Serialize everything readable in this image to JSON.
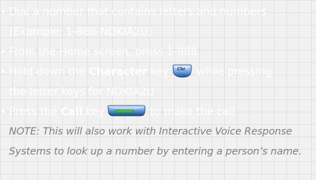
{
  "instructions": {
    "bullet": "•",
    "step1": {
      "line1": "Dial a number that contains letters and numbers",
      "line2": "(Example: 1-888-NOKIA2U)"
    },
    "step2": {
      "line1": "From the Home screen, press 1-888"
    },
    "step3": {
      "pre": "Hold down the ",
      "bold": "Character",
      "mid": " key",
      "icon": "character-key-icon",
      "post": "while pressing",
      "line2": "the letter keys for NOKIA2U"
    },
    "step4": {
      "pre": "Press the ",
      "bold": "Call",
      "mid": " key",
      "icon": "call-key-icon",
      "post": "to make the call"
    },
    "note": {
      "line1": "NOTE: This will also work with Interactive Voice Response",
      "line2": "Systems to look up a number by entering a person’s name."
    }
  },
  "colors": {
    "background": "#f1f1f1",
    "text": "#ffffff",
    "note": "#7f7f7f",
    "call_key_green": "#3fbf3f",
    "key_blue": "#1e5ea8"
  }
}
